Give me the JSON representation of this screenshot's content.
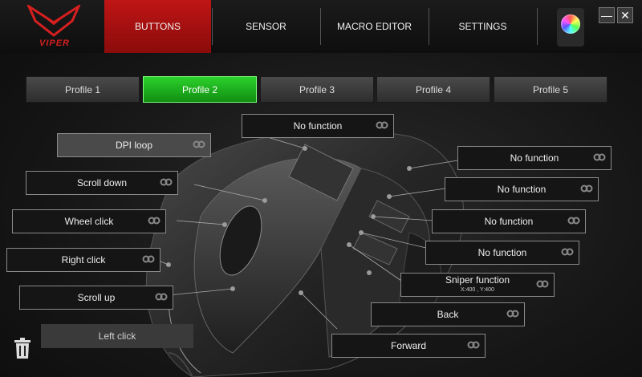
{
  "brand": {
    "logo_text": "VIPER",
    "accent": "#c01515",
    "active_profile_color": "#1fb01f"
  },
  "tabs": [
    {
      "label": "BUTTONS",
      "active": true
    },
    {
      "label": "SENSOR",
      "active": false
    },
    {
      "label": "MACRO EDITOR",
      "active": false
    },
    {
      "label": "SETTINGS",
      "active": false
    }
  ],
  "window": {
    "minimize_label": "—",
    "close_label": "✕"
  },
  "profiles": [
    {
      "label": "Profile 1",
      "active": false
    },
    {
      "label": "Profile 2",
      "active": true
    },
    {
      "label": "Profile 3",
      "active": false
    },
    {
      "label": "Profile 4",
      "active": false
    },
    {
      "label": "Profile 5",
      "active": false
    }
  ],
  "assignments": {
    "top": "No function",
    "dpi_loop": "DPI loop",
    "scroll_down": "Scroll down",
    "wheel_click": "Wheel click",
    "right_click": "Right click",
    "scroll_up": "Scroll up",
    "left_click": "Left click",
    "side_1": "No function",
    "side_2": "No function",
    "side_3": "No function",
    "side_4": "No function",
    "sniper": "Sniper function",
    "sniper_sub": "X:400 , Y:400",
    "back": "Back",
    "forward": "Forward"
  },
  "icons": {
    "link": "link-icon",
    "trash": "trash-icon",
    "color": "color-wheel-icon"
  }
}
